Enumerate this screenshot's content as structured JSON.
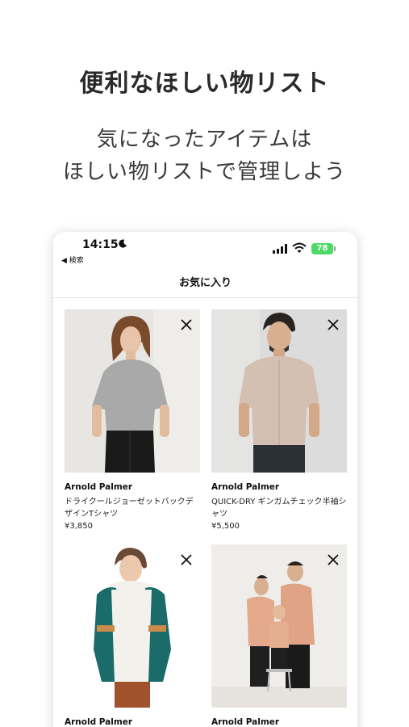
{
  "promo": {
    "headline": "便利なほしい物リスト",
    "subline_1": "気になったアイテムは",
    "subline_2": "ほしい物リストで管理しよう"
  },
  "status_bar": {
    "time": "14:15",
    "back_label": "◀ 検索",
    "battery": "78"
  },
  "nav": {
    "title": "お気に入り"
  },
  "items": [
    {
      "brand": "Arnold Palmer",
      "name": "ドライクールジョーゼットバックデザインTシャツ",
      "price": "¥3,850"
    },
    {
      "brand": "Arnold Palmer",
      "name": "QUICK-DRY ギンガムチェック半袖シャツ",
      "price": "¥5,500"
    },
    {
      "brand": "Arnold Palmer",
      "name": "",
      "price": ""
    },
    {
      "brand": "Arnold Palmer",
      "name": "",
      "price": ""
    }
  ],
  "icons": {
    "remove": "close-icon",
    "moon": "moon-icon",
    "signal": "cellular-signal-icon",
    "wifi": "wifi-icon",
    "battery": "battery-icon"
  },
  "colors": {
    "battery": "#4cd964",
    "text": "#222222",
    "photo_bg": "#e9e7e4"
  }
}
